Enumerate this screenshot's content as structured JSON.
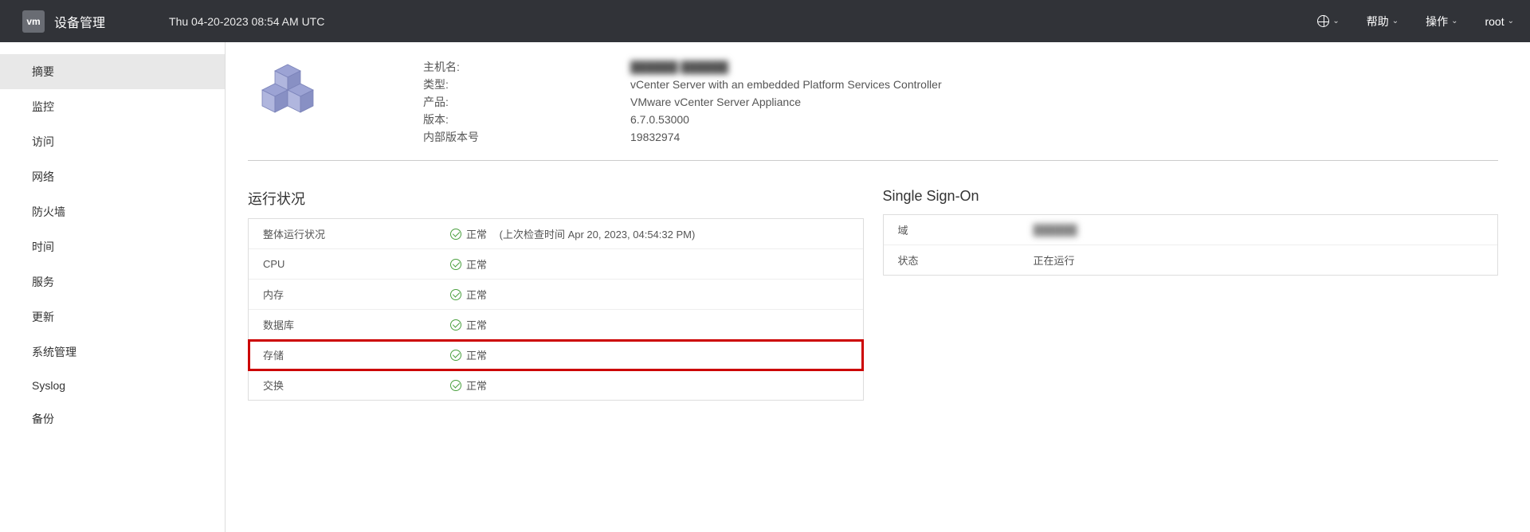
{
  "header": {
    "logo_text": "vm",
    "app_title": "设备管理",
    "timestamp": "Thu 04-20-2023 08:54 AM UTC",
    "help": "帮助",
    "actions": "操作",
    "user": "root"
  },
  "sidebar": {
    "items": [
      {
        "label": "摘要",
        "active": true
      },
      {
        "label": "监控",
        "active": false
      },
      {
        "label": "访问",
        "active": false
      },
      {
        "label": "网络",
        "active": false
      },
      {
        "label": "防火墙",
        "active": false
      },
      {
        "label": "时间",
        "active": false
      },
      {
        "label": "服务",
        "active": false
      },
      {
        "label": "更新",
        "active": false
      },
      {
        "label": "系统管理",
        "active": false
      },
      {
        "label": "Syslog",
        "active": false
      },
      {
        "label": "备份",
        "active": false
      }
    ]
  },
  "summary": {
    "labels": {
      "hostname": "主机名:",
      "type": "类型:",
      "product": "产品:",
      "version": "版本:",
      "build": "内部版本号"
    },
    "values": {
      "hostname": "██████  ██████",
      "type": "vCenter Server with an embedded Platform Services Controller",
      "product": "VMware vCenter Server Appliance",
      "version": "6.7.0.53000",
      "build": "19832974"
    }
  },
  "health": {
    "title": "运行状况",
    "ok": "正常",
    "overall_suffix": "(上次检查时间 Apr 20, 2023, 04:54:32 PM)",
    "rows": {
      "overall": "整体运行状况",
      "cpu": "CPU",
      "memory": "内存",
      "database": "数据库",
      "storage": "存储",
      "swap": "交换"
    }
  },
  "sso": {
    "title": "Single Sign-On",
    "domain_label": "域",
    "domain_value": "██████",
    "state_label": "状态",
    "state_value": "正在运行"
  }
}
